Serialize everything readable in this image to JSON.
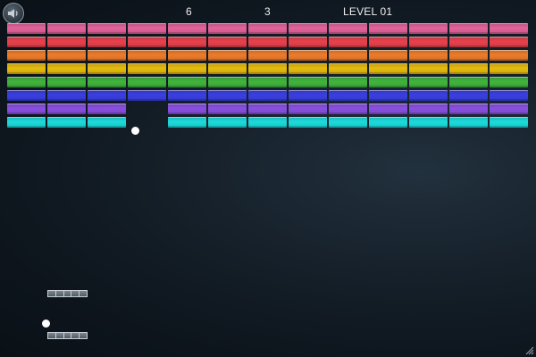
{
  "hud": {
    "score": "6",
    "lives": "3",
    "level": "LEVEL 01"
  },
  "icons": {
    "sound": "speaker-icon",
    "resize": "resize-grip-icon"
  },
  "brick_grid": {
    "columns": 13,
    "rows": [
      {
        "name": "pink",
        "color": "#e3639a",
        "missing": []
      },
      {
        "name": "red",
        "color": "#e9414c",
        "missing": []
      },
      {
        "name": "orange",
        "color": "#ee7c2a",
        "missing": []
      },
      {
        "name": "yellow",
        "color": "#e8bb0c",
        "missing": []
      },
      {
        "name": "green",
        "color": "#40b53c",
        "missing": []
      },
      {
        "name": "blue",
        "color": "#3a3fe0",
        "missing": []
      },
      {
        "name": "purple",
        "color": "#8a4fe0",
        "missing": [
          3
        ]
      },
      {
        "name": "cyan",
        "color": "#1cdcdc",
        "missing": [
          3
        ]
      }
    ]
  },
  "colors": {
    "ball": "#ffffff",
    "paddle_outline": "#c9cfd4"
  }
}
